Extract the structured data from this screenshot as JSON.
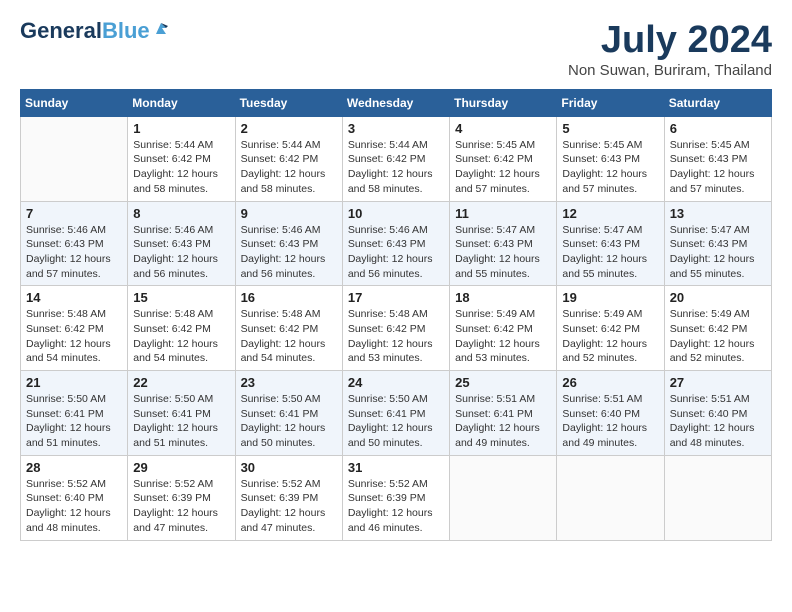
{
  "header": {
    "logo_line1": "General",
    "logo_line2": "Blue",
    "month": "July 2024",
    "location": "Non Suwan, Buriram, Thailand"
  },
  "days_of_week": [
    "Sunday",
    "Monday",
    "Tuesday",
    "Wednesday",
    "Thursday",
    "Friday",
    "Saturday"
  ],
  "weeks": [
    [
      {
        "day": "",
        "sunrise": "",
        "sunset": "",
        "daylight": ""
      },
      {
        "day": "1",
        "sunrise": "Sunrise: 5:44 AM",
        "sunset": "Sunset: 6:42 PM",
        "daylight": "Daylight: 12 hours and 58 minutes."
      },
      {
        "day": "2",
        "sunrise": "Sunrise: 5:44 AM",
        "sunset": "Sunset: 6:42 PM",
        "daylight": "Daylight: 12 hours and 58 minutes."
      },
      {
        "day": "3",
        "sunrise": "Sunrise: 5:44 AM",
        "sunset": "Sunset: 6:42 PM",
        "daylight": "Daylight: 12 hours and 58 minutes."
      },
      {
        "day": "4",
        "sunrise": "Sunrise: 5:45 AM",
        "sunset": "Sunset: 6:42 PM",
        "daylight": "Daylight: 12 hours and 57 minutes."
      },
      {
        "day": "5",
        "sunrise": "Sunrise: 5:45 AM",
        "sunset": "Sunset: 6:43 PM",
        "daylight": "Daylight: 12 hours and 57 minutes."
      },
      {
        "day": "6",
        "sunrise": "Sunrise: 5:45 AM",
        "sunset": "Sunset: 6:43 PM",
        "daylight": "Daylight: 12 hours and 57 minutes."
      }
    ],
    [
      {
        "day": "7",
        "sunrise": "Sunrise: 5:46 AM",
        "sunset": "Sunset: 6:43 PM",
        "daylight": "Daylight: 12 hours and 57 minutes."
      },
      {
        "day": "8",
        "sunrise": "Sunrise: 5:46 AM",
        "sunset": "Sunset: 6:43 PM",
        "daylight": "Daylight: 12 hours and 56 minutes."
      },
      {
        "day": "9",
        "sunrise": "Sunrise: 5:46 AM",
        "sunset": "Sunset: 6:43 PM",
        "daylight": "Daylight: 12 hours and 56 minutes."
      },
      {
        "day": "10",
        "sunrise": "Sunrise: 5:46 AM",
        "sunset": "Sunset: 6:43 PM",
        "daylight": "Daylight: 12 hours and 56 minutes."
      },
      {
        "day": "11",
        "sunrise": "Sunrise: 5:47 AM",
        "sunset": "Sunset: 6:43 PM",
        "daylight": "Daylight: 12 hours and 55 minutes."
      },
      {
        "day": "12",
        "sunrise": "Sunrise: 5:47 AM",
        "sunset": "Sunset: 6:43 PM",
        "daylight": "Daylight: 12 hours and 55 minutes."
      },
      {
        "day": "13",
        "sunrise": "Sunrise: 5:47 AM",
        "sunset": "Sunset: 6:43 PM",
        "daylight": "Daylight: 12 hours and 55 minutes."
      }
    ],
    [
      {
        "day": "14",
        "sunrise": "Sunrise: 5:48 AM",
        "sunset": "Sunset: 6:42 PM",
        "daylight": "Daylight: 12 hours and 54 minutes."
      },
      {
        "day": "15",
        "sunrise": "Sunrise: 5:48 AM",
        "sunset": "Sunset: 6:42 PM",
        "daylight": "Daylight: 12 hours and 54 minutes."
      },
      {
        "day": "16",
        "sunrise": "Sunrise: 5:48 AM",
        "sunset": "Sunset: 6:42 PM",
        "daylight": "Daylight: 12 hours and 54 minutes."
      },
      {
        "day": "17",
        "sunrise": "Sunrise: 5:48 AM",
        "sunset": "Sunset: 6:42 PM",
        "daylight": "Daylight: 12 hours and 53 minutes."
      },
      {
        "day": "18",
        "sunrise": "Sunrise: 5:49 AM",
        "sunset": "Sunset: 6:42 PM",
        "daylight": "Daylight: 12 hours and 53 minutes."
      },
      {
        "day": "19",
        "sunrise": "Sunrise: 5:49 AM",
        "sunset": "Sunset: 6:42 PM",
        "daylight": "Daylight: 12 hours and 52 minutes."
      },
      {
        "day": "20",
        "sunrise": "Sunrise: 5:49 AM",
        "sunset": "Sunset: 6:42 PM",
        "daylight": "Daylight: 12 hours and 52 minutes."
      }
    ],
    [
      {
        "day": "21",
        "sunrise": "Sunrise: 5:50 AM",
        "sunset": "Sunset: 6:41 PM",
        "daylight": "Daylight: 12 hours and 51 minutes."
      },
      {
        "day": "22",
        "sunrise": "Sunrise: 5:50 AM",
        "sunset": "Sunset: 6:41 PM",
        "daylight": "Daylight: 12 hours and 51 minutes."
      },
      {
        "day": "23",
        "sunrise": "Sunrise: 5:50 AM",
        "sunset": "Sunset: 6:41 PM",
        "daylight": "Daylight: 12 hours and 50 minutes."
      },
      {
        "day": "24",
        "sunrise": "Sunrise: 5:50 AM",
        "sunset": "Sunset: 6:41 PM",
        "daylight": "Daylight: 12 hours and 50 minutes."
      },
      {
        "day": "25",
        "sunrise": "Sunrise: 5:51 AM",
        "sunset": "Sunset: 6:41 PM",
        "daylight": "Daylight: 12 hours and 49 minutes."
      },
      {
        "day": "26",
        "sunrise": "Sunrise: 5:51 AM",
        "sunset": "Sunset: 6:40 PM",
        "daylight": "Daylight: 12 hours and 49 minutes."
      },
      {
        "day": "27",
        "sunrise": "Sunrise: 5:51 AM",
        "sunset": "Sunset: 6:40 PM",
        "daylight": "Daylight: 12 hours and 48 minutes."
      }
    ],
    [
      {
        "day": "28",
        "sunrise": "Sunrise: 5:52 AM",
        "sunset": "Sunset: 6:40 PM",
        "daylight": "Daylight: 12 hours and 48 minutes."
      },
      {
        "day": "29",
        "sunrise": "Sunrise: 5:52 AM",
        "sunset": "Sunset: 6:39 PM",
        "daylight": "Daylight: 12 hours and 47 minutes."
      },
      {
        "day": "30",
        "sunrise": "Sunrise: 5:52 AM",
        "sunset": "Sunset: 6:39 PM",
        "daylight": "Daylight: 12 hours and 47 minutes."
      },
      {
        "day": "31",
        "sunrise": "Sunrise: 5:52 AM",
        "sunset": "Sunset: 6:39 PM",
        "daylight": "Daylight: 12 hours and 46 minutes."
      },
      {
        "day": "",
        "sunrise": "",
        "sunset": "",
        "daylight": ""
      },
      {
        "day": "",
        "sunrise": "",
        "sunset": "",
        "daylight": ""
      },
      {
        "day": "",
        "sunrise": "",
        "sunset": "",
        "daylight": ""
      }
    ]
  ]
}
